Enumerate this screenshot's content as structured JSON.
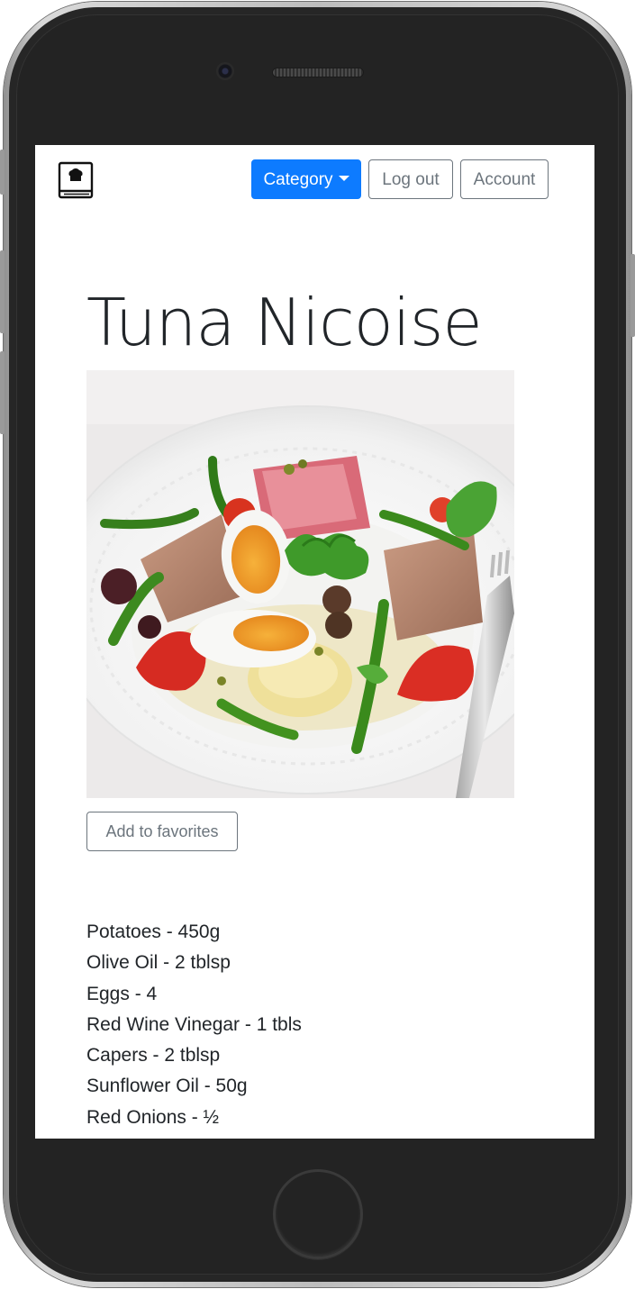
{
  "device": {
    "type": "smartphone",
    "frame_color": "#262626"
  },
  "navbar": {
    "brand_icon": "chef-recipe-book-icon",
    "category_label": "Category",
    "logout_label": "Log out",
    "account_label": "Account",
    "accent_color": "#0d7bff"
  },
  "recipe": {
    "title": "Tuna Nicoise",
    "photo": "tuna-nicoise-salad-photo",
    "favorite_label": "Add to favorites",
    "ingredients": [
      "Potatoes - 450g",
      "Olive Oil - 2 tblsp",
      "Eggs - 4",
      "Red Wine Vinegar - 1 tbls",
      "Capers - 2 tblsp",
      "Sunflower Oil - 50g",
      "Red Onions - ½"
    ]
  }
}
